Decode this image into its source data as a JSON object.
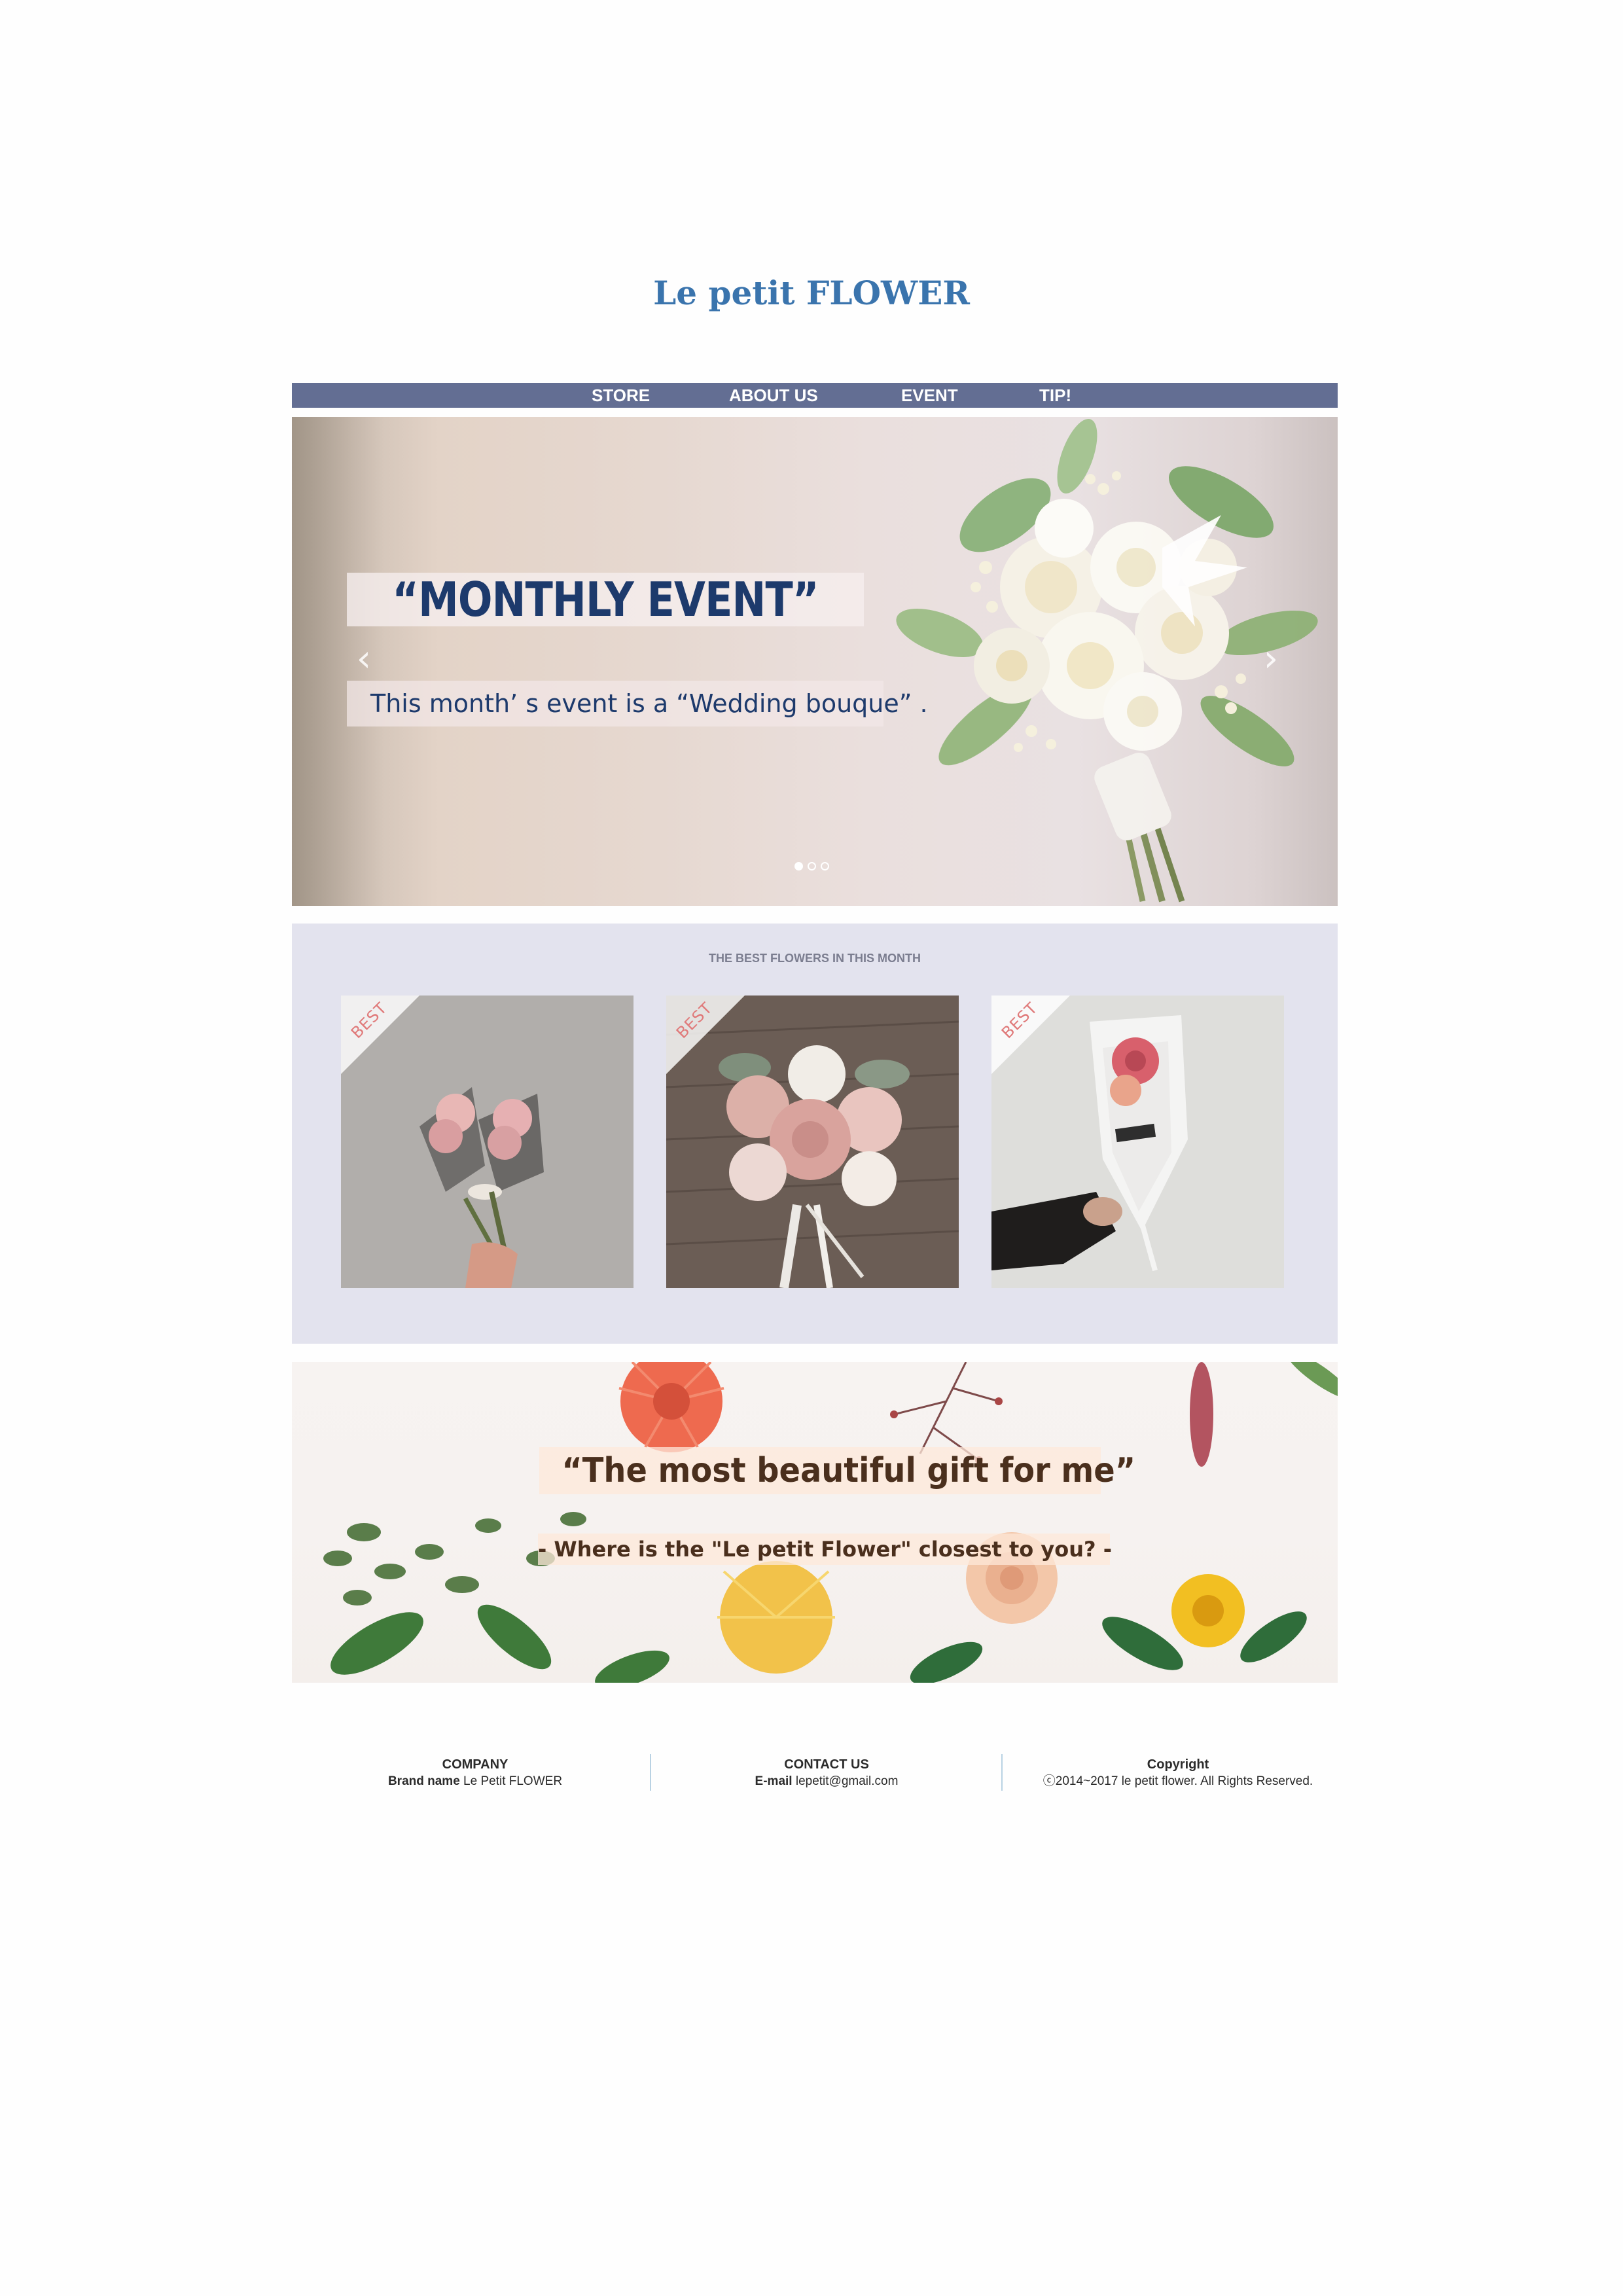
{
  "header": {
    "logo": "Le petit FLOWER"
  },
  "nav": {
    "items": [
      {
        "label": "STORE"
      },
      {
        "label": "ABOUT US"
      },
      {
        "label": "EVENT"
      },
      {
        "label": "TIP!"
      }
    ]
  },
  "hero": {
    "title": "“MONTHLY EVENT”",
    "subtitle": "This month’ s event is a “Wedding bouque” .",
    "prev_icon": "chevron-left-icon",
    "next_icon": "chevron-right-icon",
    "slide_count": 3,
    "active_slide": 1
  },
  "best": {
    "heading": "THE BEST FLOWERS IN THIS MONTH",
    "badge": "BEST",
    "cards": [
      {
        "badge": "BEST"
      },
      {
        "badge": "BEST"
      },
      {
        "badge": "BEST"
      }
    ]
  },
  "banner": {
    "title": "“The most beautiful gift for me”",
    "subtitle": "- Where is the \"Le petit Flower\" closest to you? -"
  },
  "footer": {
    "company": {
      "heading": "COMPANY",
      "label": "Brand name",
      "value": "Le Petit FLOWER"
    },
    "contact": {
      "heading": "CONTACT US",
      "label": "E-mail",
      "value": "lepetit@gmail.com"
    },
    "copyright": {
      "heading": "Copyright",
      "text": "ⓒ2014~2017 le petit flower. All Rights Reserved."
    }
  },
  "colors": {
    "logo": "#3a74ad",
    "nav_bg": "#636e93",
    "best_bg": "#e3e3ee",
    "hero_text": "#1d3a6c",
    "banner_text": "#4a2f1d",
    "badge_text": "#e07a7a"
  }
}
